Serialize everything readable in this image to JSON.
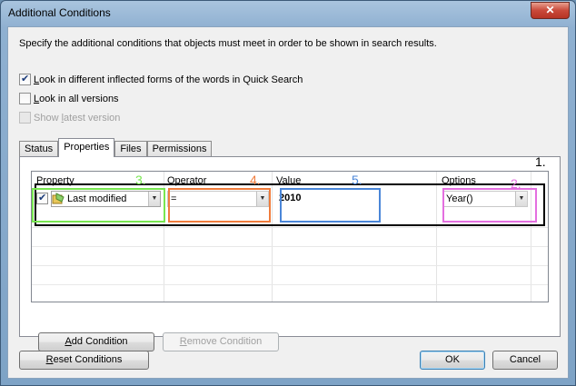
{
  "window": {
    "title": "Additional Conditions",
    "close_glyph": "✕"
  },
  "instruction": "Specify the additional conditions that objects must meet in order to be shown in search results.",
  "options": [
    {
      "label_u": "L",
      "label_rest": "ook in different inflected forms of the words in Quick Search",
      "checked": true,
      "enabled": true
    },
    {
      "label_u": "L",
      "label_rest": "ook in all versions",
      "checked": false,
      "enabled": true
    },
    {
      "label_pre": "Show ",
      "label_u": "l",
      "label_rest": "atest version",
      "checked": false,
      "enabled": false
    }
  ],
  "tabs": [
    "Status",
    "Properties",
    "Files",
    "Permissions"
  ],
  "active_tab": "Properties",
  "grid": {
    "headers": {
      "property": "Property",
      "operator": "Operator",
      "value": "Value",
      "options": "Options"
    },
    "row": {
      "checked": true,
      "property": "Last modified",
      "operator": "=",
      "value": "2010",
      "options": "Year()"
    }
  },
  "annotations": [
    {
      "label": "1.",
      "color": "#000000"
    },
    {
      "label": "2.",
      "color": "#e46fe0"
    },
    {
      "label": "3.",
      "color": "#78e650"
    },
    {
      "label": "4.",
      "color": "#f07c3c"
    },
    {
      "label": "5.",
      "color": "#4a86d8"
    }
  ],
  "buttons": {
    "add_condition_u": "A",
    "add_condition_rest": "dd Condition",
    "remove_condition_u": "R",
    "remove_condition_rest": "emove Condition",
    "reset_conditions_u": "R",
    "reset_conditions_rest": "eset Conditions",
    "ok": "OK",
    "cancel": "Cancel"
  }
}
